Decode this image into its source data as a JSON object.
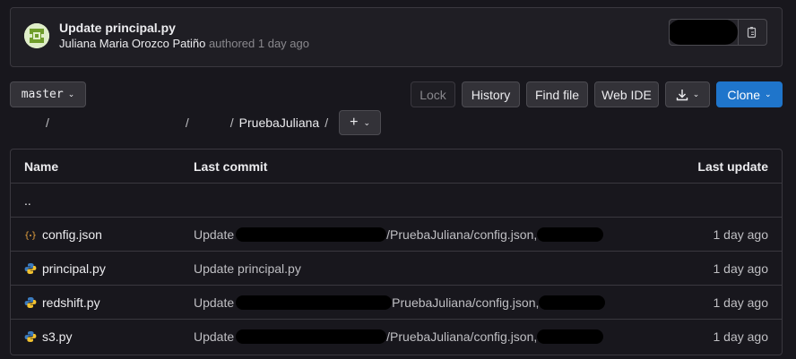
{
  "commit": {
    "title": "Update principal.py",
    "author": "Juliana Maria Orozco Patiño",
    "meta": "authored 1 day ago"
  },
  "toolbar": {
    "branch": "master",
    "lock": "Lock",
    "history": "History",
    "find_file": "Find file",
    "web_ide": "Web IDE",
    "clone": "Clone"
  },
  "breadcrumb": {
    "current": "PruebaJuliana",
    "separator": "/",
    "add": "+"
  },
  "table": {
    "headers": {
      "name": "Name",
      "last_commit": "Last commit",
      "last_update": "Last update"
    },
    "parent": "..",
    "rows": [
      {
        "name": "config.json",
        "icon": "json-file-icon",
        "commit_prefix": "Update",
        "commit_suffix": "/PruebaJuliana/config.json,",
        "updated": "1 day ago"
      },
      {
        "name": "principal.py",
        "icon": "python-file-icon",
        "commit_prefix": "Update principal.py",
        "commit_suffix": "",
        "updated": "1 day ago"
      },
      {
        "name": "redshift.py",
        "icon": "python-file-icon",
        "commit_prefix": "Update",
        "commit_suffix": "PruebaJuliana/config.json,",
        "updated": "1 day ago"
      },
      {
        "name": "s3.py",
        "icon": "python-file-icon",
        "commit_prefix": "Update",
        "commit_suffix": "/PruebaJuliana/config.json,",
        "updated": "1 day ago"
      }
    ]
  },
  "colors": {
    "accent": "#1f75cb",
    "background": "#18171d",
    "border": "#3a383f"
  }
}
